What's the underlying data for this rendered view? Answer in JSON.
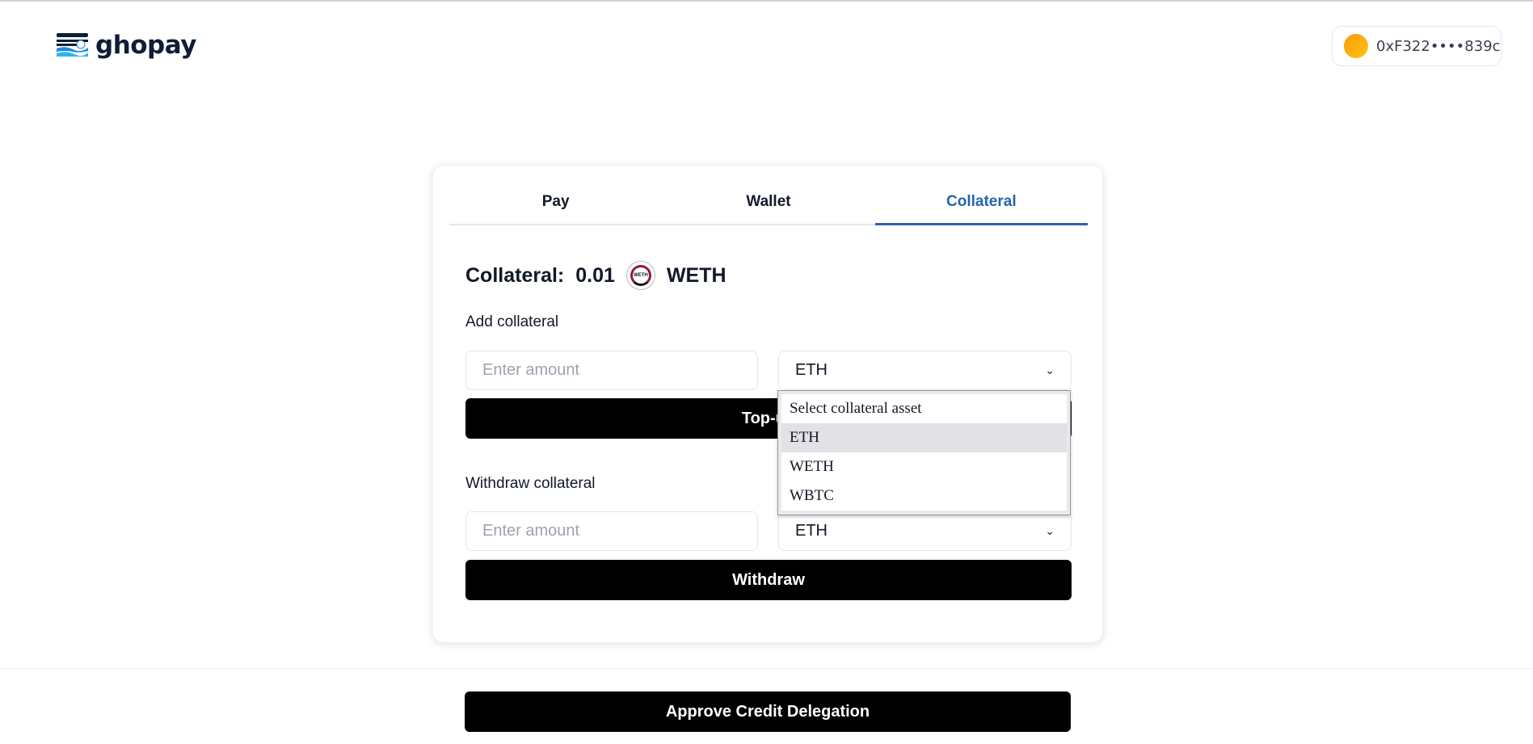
{
  "header": {
    "brand": "ghopay",
    "wallet_address": "0xF322••••839c"
  },
  "tabs": [
    {
      "label": "Pay"
    },
    {
      "label": "Wallet"
    },
    {
      "label": "Collateral"
    }
  ],
  "collateral": {
    "label": "Collateral:",
    "amount": "0.01",
    "token_icon_text": "WETH",
    "token": "WETH"
  },
  "add": {
    "label": "Add collateral",
    "placeholder": "Enter amount",
    "selected": "ETH",
    "button": "Top-up"
  },
  "dropdown": {
    "options": [
      "Select collateral asset",
      "ETH",
      "WETH",
      "WBTC"
    ],
    "highlighted": "ETH"
  },
  "withdraw": {
    "label": "Withdraw collateral",
    "placeholder": "Enter amount",
    "selected": "ETH",
    "button": "Withdraw"
  },
  "approve_button": "Approve Credit Delegation",
  "colors": {
    "accent": "#2d62a8",
    "button": "#000000"
  }
}
